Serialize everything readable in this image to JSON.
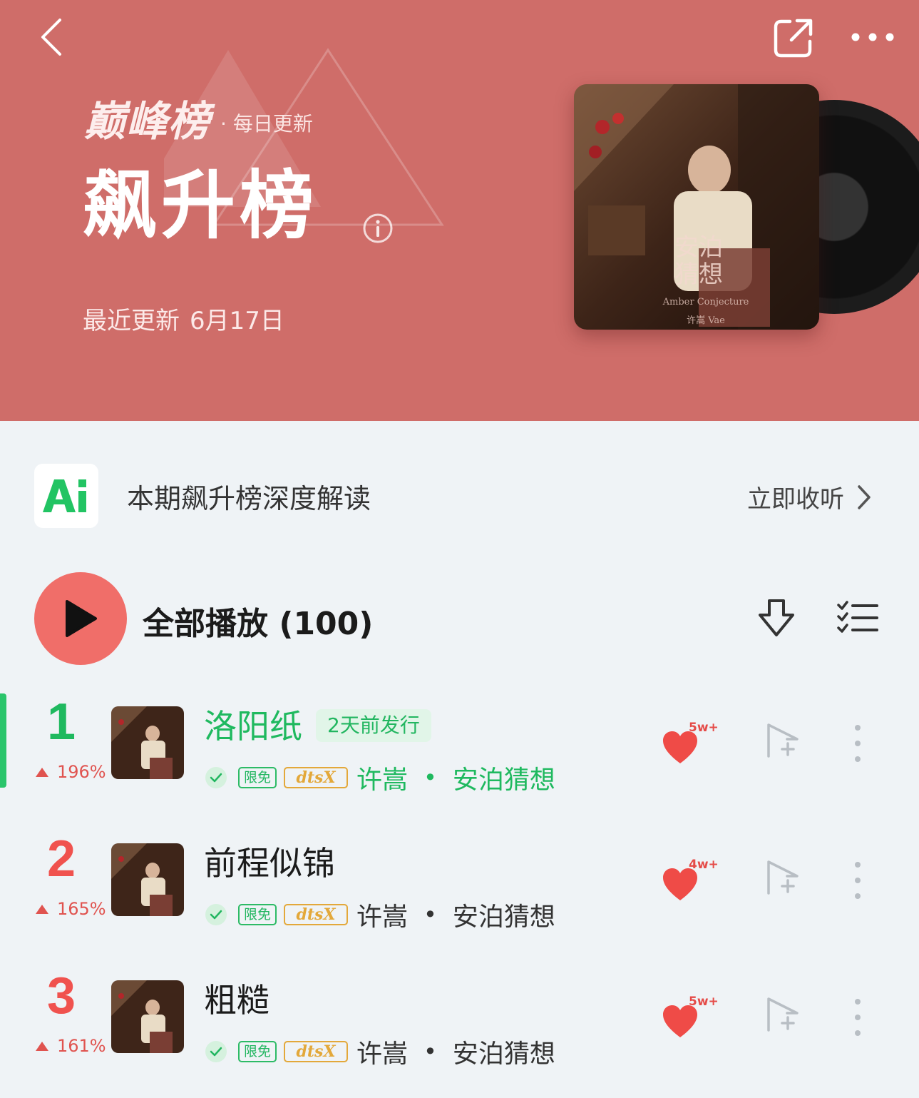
{
  "header": {
    "brand": "巅峰榜",
    "brand_sub": "· 每日更新",
    "title": "飙升榜",
    "update_label": "最近更新",
    "update_date": "6月17日",
    "accent": "#cf6d69"
  },
  "cover": {
    "title_line1": "安泊",
    "title_line2": "猜想",
    "subtitle": "Amber Conjecture",
    "artist_line": "许嵩 Vae"
  },
  "ai_banner": {
    "logo_text": "Ai",
    "text": "本期飙升榜深度解读",
    "action": "立即收听"
  },
  "play_all": {
    "label": "全部播放",
    "count": "(100)"
  },
  "songs": [
    {
      "rank": "1",
      "change": "196%",
      "title": "洛阳纸",
      "release_badge": "2天前发行",
      "tag_free": "限免",
      "tag_dts": "dtsX",
      "artist": "许嵩",
      "separator": "•",
      "album": "安泊猜想",
      "likes": "5w+",
      "active": true
    },
    {
      "rank": "2",
      "change": "165%",
      "title": "前程似锦",
      "tag_free": "限免",
      "tag_dts": "dtsX",
      "artist": "许嵩",
      "separator": "•",
      "album": "安泊猜想",
      "likes": "4w+",
      "active": false
    },
    {
      "rank": "3",
      "change": "161%",
      "title": "粗糙",
      "tag_free": "限免",
      "tag_dts": "dtsX",
      "artist": "许嵩",
      "separator": "•",
      "album": "安泊猜想",
      "likes": "5w+",
      "active": false
    }
  ],
  "icons": {
    "back": "chevron-left-icon",
    "share": "share-icon",
    "more": "more-horizontal-icon",
    "info": "info-icon",
    "play": "play-icon",
    "download": "download-icon",
    "multi_select": "multi-select-icon",
    "like": "heart-icon",
    "add": "add-to-playlist-icon",
    "song_more": "more-vertical-icon"
  }
}
